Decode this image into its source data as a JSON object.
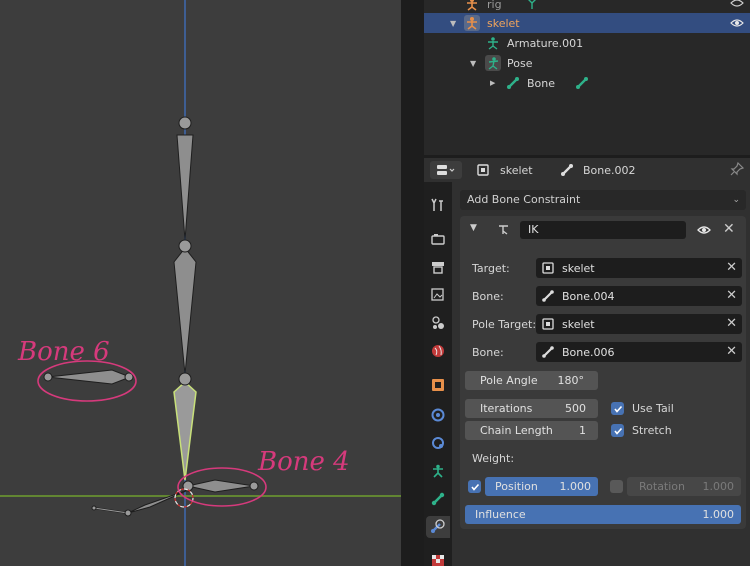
{
  "outliner": {
    "rows": [
      {
        "label": "rig",
        "icon": "armature-object-icon"
      },
      {
        "label": "skelet",
        "icon": "armature-object-icon"
      },
      {
        "label": "Armature.001",
        "icon": "armature-data-icon"
      },
      {
        "label": "Pose",
        "icon": "pose-icon"
      },
      {
        "label": "Bone",
        "icon": "bone-icon"
      }
    ]
  },
  "properties": {
    "object_name": "skelet",
    "bone_name": "Bone.002",
    "add_constraint_label": "Add Bone Constraint",
    "constraint": {
      "name": "IK",
      "target_label": "Target:",
      "target_value": "skelet",
      "bone_label": "Bone:",
      "bone_value": "Bone.004",
      "pole_target_label": "Pole Target:",
      "pole_target_value": "skelet",
      "pole_bone_label": "Bone:",
      "pole_bone_value": "Bone.006",
      "pole_angle_label": "Pole Angle",
      "pole_angle_value": "180°",
      "iterations_label": "Iterations",
      "iterations_value": "500",
      "use_tail_label": "Use Tail",
      "use_tail_checked": true,
      "chain_length_label": "Chain Length",
      "chain_length_value": "1",
      "stretch_label": "Stretch",
      "stretch_checked": true,
      "weight_label": "Weight:",
      "position_label": "Position",
      "position_value": "1.000",
      "position_checked": true,
      "rotation_label": "Rotation",
      "rotation_value": "1.000",
      "rotation_checked": false,
      "influence_label": "Influence",
      "influence_value": "1.000"
    }
  },
  "annotations": {
    "bone6": "Bone 6",
    "bone4": "Bone 4"
  },
  "colors": {
    "selection_blue": "#334d80",
    "button_blue": "#4772b3",
    "annotation_pink": "#d63a7c",
    "bone_active": "#c8e07a",
    "x_axis": "#6f9e2e",
    "z_axis": "#3f6ab0"
  },
  "property_tabs": [
    "tool-icon",
    "render-icon",
    "output-icon",
    "view-layer-icon",
    "scene-icon",
    "world-icon",
    "object-icon",
    "modifiers-icon",
    "particles-icon",
    "physics-icon",
    "object-data-icon",
    "bone-icon",
    "bone-constraint-icon",
    "texture-icon"
  ]
}
